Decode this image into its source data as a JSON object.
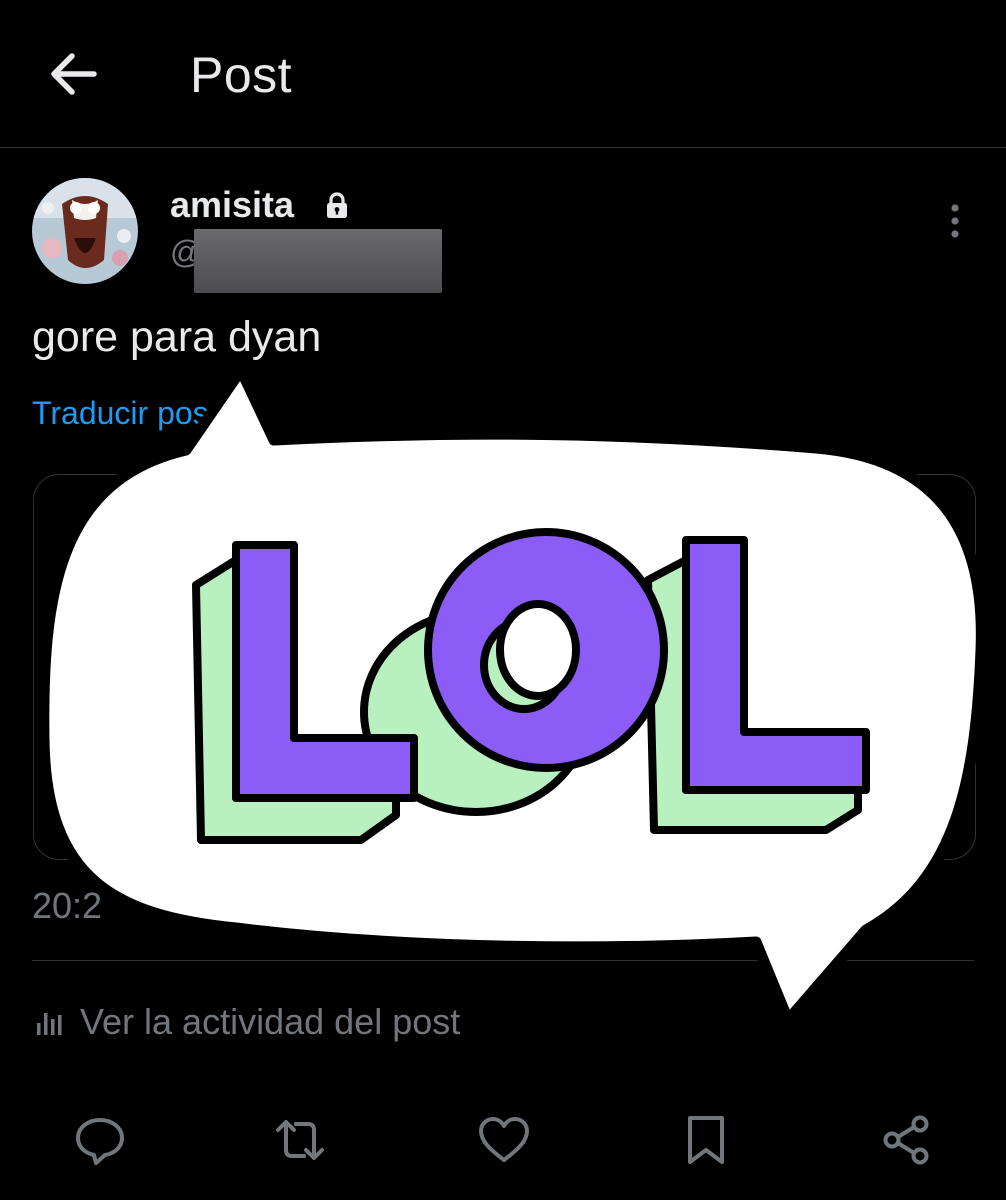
{
  "header": {
    "title": "Post",
    "back_icon": "arrow-left-icon"
  },
  "post": {
    "author": {
      "display_name": "amisita",
      "handle_prefix": "@",
      "protected_icon": "lock-icon",
      "avatar_icon": "avatar"
    },
    "text": "gore para dyan",
    "translate_label": "Traducir post",
    "translate_visible": "Traducir pos",
    "timestamp": "20:23",
    "timestamp_visible": "20:2",
    "more_icon": "more-vertical-icon"
  },
  "activity": {
    "label": "Ver la actividad del post",
    "icon": "bar-chart-icon"
  },
  "actions": [
    {
      "name": "reply",
      "icon": "comment-icon"
    },
    {
      "name": "repost",
      "icon": "repost-icon"
    },
    {
      "name": "like",
      "icon": "heart-icon"
    },
    {
      "name": "bookmark",
      "icon": "bookmark-icon"
    },
    {
      "name": "share",
      "icon": "share-icon"
    }
  ],
  "sticker": {
    "text": "LOL",
    "letter_color": "#8b5cf6",
    "shadow_color": "#b9f0c0",
    "bubble_color": "#ffffff"
  },
  "colors": {
    "background": "#000000",
    "text_primary": "#e7e9ea",
    "text_secondary": "#71767b",
    "link": "#1d9bf0",
    "border": "#2f3336"
  }
}
